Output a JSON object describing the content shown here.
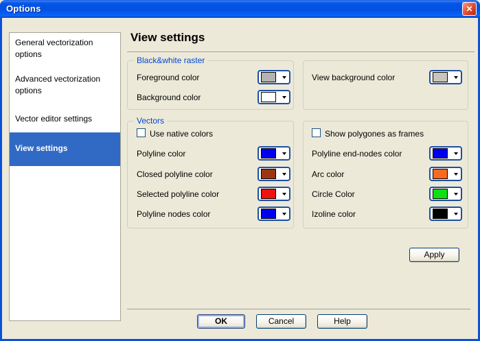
{
  "window": {
    "title": "Options"
  },
  "icons": {
    "close": "✕"
  },
  "sidebar": {
    "items": [
      {
        "label": "General vectorization options",
        "selected": false
      },
      {
        "label": "Advanced vectorization options",
        "selected": false
      },
      {
        "label": "Vector editor settings",
        "selected": false
      },
      {
        "label": "View settings",
        "selected": true
      }
    ]
  },
  "main": {
    "heading": "View settings",
    "bw_raster": {
      "title": "Black&white raster",
      "rows": [
        {
          "label": "Foreground color",
          "color": "#B3B3B3"
        },
        {
          "label": "Background color",
          "color": "#FFFFFF"
        }
      ]
    },
    "view_bg": {
      "rows": [
        {
          "label": "View background color",
          "color": "#C8C5BC"
        }
      ]
    },
    "vectors": {
      "title": "Vectors",
      "left": {
        "checkbox": {
          "label": "Use native colors",
          "checked": false
        },
        "rows": [
          {
            "label": "Polyline color",
            "color": "#0000F0"
          },
          {
            "label": "Closed polyline color",
            "color": "#9C3511"
          },
          {
            "label": "Selected polyline color",
            "color": "#F01111"
          },
          {
            "label": "Polyline nodes color",
            "color": "#0000F0"
          }
        ]
      },
      "right": {
        "checkbox": {
          "label": "Show polygones as frames",
          "checked": false
        },
        "rows": [
          {
            "label": "Polyline end-nodes color",
            "color": "#0000F0"
          },
          {
            "label": "Arc color",
            "color": "#F96A20"
          },
          {
            "label": "Circle Color",
            "color": "#12DE12"
          },
          {
            "label": "Izoline color",
            "color": "#000000"
          }
        ]
      }
    },
    "apply_label": "Apply"
  },
  "footer": {
    "ok_label": "OK",
    "cancel_label": "Cancel",
    "help_label": "Help"
  },
  "colors": {
    "dialog_bg": "#ECE9D8",
    "selection": "#316AC5",
    "groupbox_title": "#0046D5",
    "titlebar_blue": "#0354E6"
  }
}
